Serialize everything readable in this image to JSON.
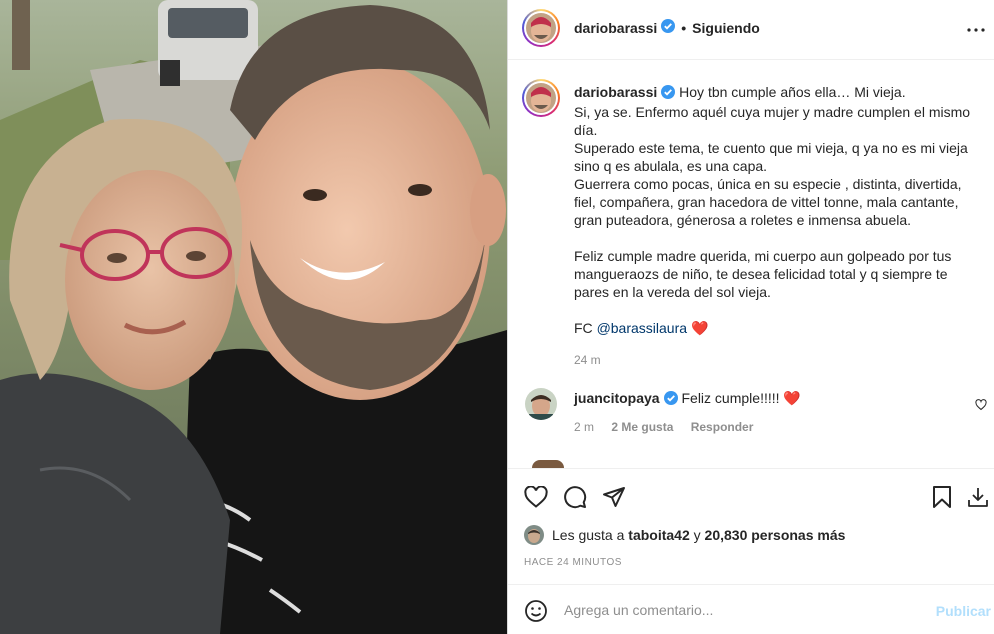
{
  "post": {
    "username": "dariobarassi",
    "following_label": "Siguiendo",
    "more_icon": "more-horizontal-icon"
  },
  "caption": {
    "username": "dariobarassi",
    "lines": [
      "Hoy tbn cumple años ella… Mi vieja.",
      "Si, ya se. Enfermo aquél cuya mujer y madre cumplen el mismo día.",
      "Superado este tema, te cuento que mi vieja, q ya no es mi vieja sino q es abulala, es una capa.",
      "Guerrera como pocas, única en su especie , distinta, divertida, fiel, compañera, gran hacedora de vittel tonne, mala cantante, gran puteadora, génerosa a roletes e inmensa abuela.",
      "Feliz cumple madre querida, mi cuerpo aun golpeado por tus mangueraozs de niño, te desea felicidad total y q siempre te pares en la vereda del sol vieja."
    ],
    "credit_prefix": "FC",
    "credit_mention": "@barassilaura",
    "credit_emoji": "❤️",
    "time": "24 m"
  },
  "comment": {
    "username": "juancitopaya",
    "text": "Feliz cumple!!!!!",
    "emoji": "❤️",
    "time": "2 m",
    "likes": "2 Me gusta",
    "reply": "Responder"
  },
  "actions": {
    "likes_prefix": "Les gusta a",
    "liker": "taboita42",
    "connector": "y",
    "others": "20,830 personas más",
    "ago": "HACE 24 MINUTOS"
  },
  "add_comment": {
    "placeholder": "Agrega un comentario...",
    "publish": "Publicar"
  },
  "colors": {
    "verified": "#3897f0",
    "link": "#00376b",
    "muted": "#8e8e8e",
    "publish_disabled": "#b2dffc"
  }
}
